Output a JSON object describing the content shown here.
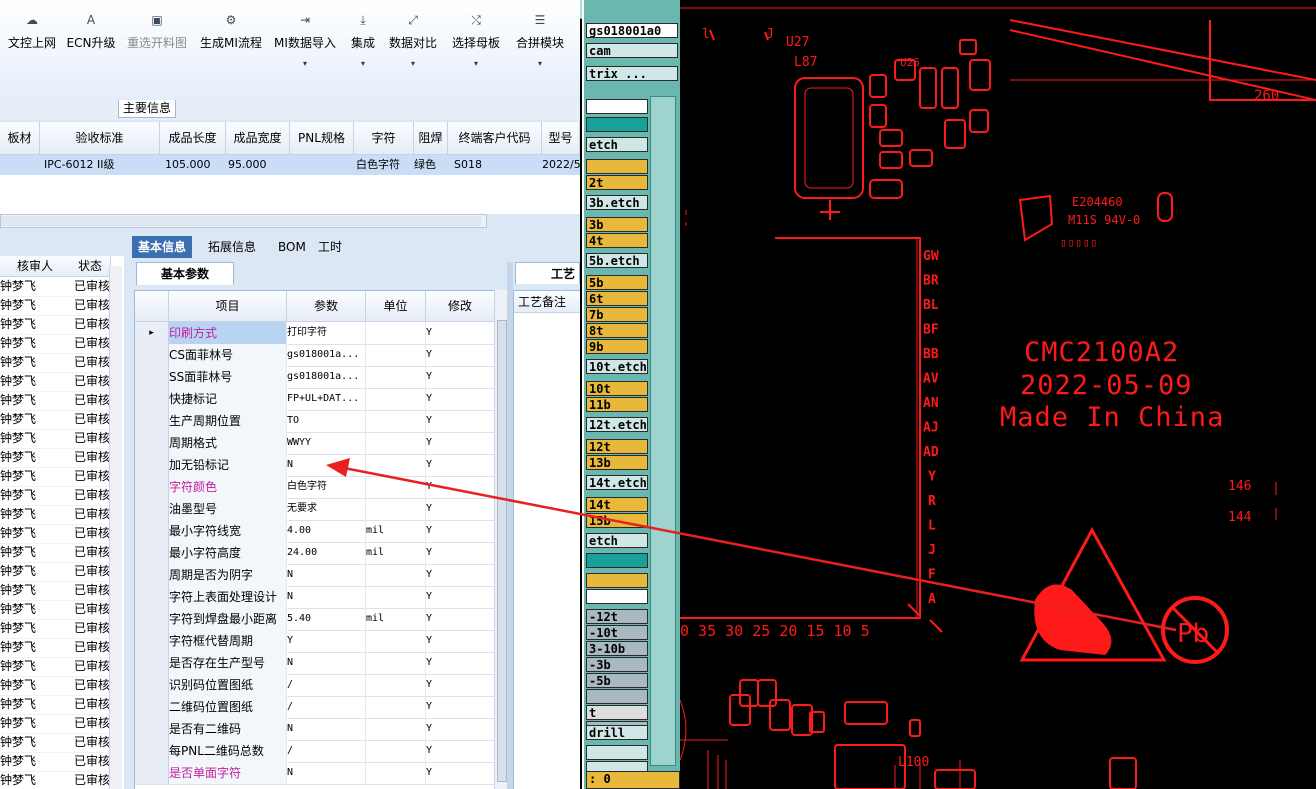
{
  "toolbar": {
    "items": [
      {
        "label": "文控上网",
        "icon": "cloud-icon",
        "glyph": "☁",
        "dropdown": false,
        "disabled": false
      },
      {
        "label": "ECN升级",
        "icon": "letter-a-icon",
        "glyph": "A",
        "dropdown": false,
        "disabled": false
      },
      {
        "label": "重选开料图",
        "icon": "image-icon",
        "glyph": "▣",
        "dropdown": false,
        "disabled": true
      },
      {
        "label": "生成MI流程",
        "icon": "gears-icon",
        "glyph": "⚙",
        "dropdown": false,
        "disabled": false
      },
      {
        "label": "MI数据导入",
        "icon": "import-icon",
        "glyph": "⇥",
        "dropdown": true,
        "disabled": false
      },
      {
        "label": "集成",
        "icon": "download-icon",
        "glyph": "⤓",
        "dropdown": true,
        "disabled": false
      },
      {
        "label": "数据对比",
        "icon": "compare-icon",
        "glyph": "⤢",
        "dropdown": true,
        "disabled": false
      },
      {
        "label": "选择母板",
        "icon": "shuffle-icon",
        "glyph": "⤭",
        "dropdown": true,
        "disabled": false
      },
      {
        "label": "合拼模块",
        "icon": "list-icon",
        "glyph": "☰",
        "dropdown": true,
        "disabled": false
      }
    ],
    "dropdown_glyph": "▾"
  },
  "main_info": {
    "title": "主要信息",
    "columns": [
      "板材",
      "验收标准",
      "成品长度",
      "成品宽度",
      "PNL规格",
      "字符",
      "阻焊",
      "终端客户代码",
      "型号"
    ],
    "row": [
      "",
      "IPC-6012 II级",
      "105.000",
      "95.000",
      "",
      "白色字符",
      "绿色",
      "S018",
      "2022/5"
    ]
  },
  "left_list": {
    "columns": [
      "核审人",
      "状态"
    ],
    "reviewer": "钟梦飞",
    "status": "已审核",
    "row_count": 27
  },
  "detail_tabs": {
    "tabs": [
      "基本信息",
      "拓展信息",
      "BOM",
      "工时"
    ],
    "active": "基本信息",
    "subtab": "基本参数",
    "side_tab": "工艺",
    "side_column": "工艺备注"
  },
  "params": {
    "columns": [
      "项目",
      "参数",
      "单位",
      "修改"
    ],
    "current_row_marker": "▸",
    "rows": [
      {
        "item": "印刷方式",
        "value": "打印字符",
        "unit": "",
        "mod": "Y",
        "highlight": true
      },
      {
        "item": "CS面菲林号",
        "value": "gs018001a...",
        "unit": "",
        "mod": "Y",
        "highlight": false
      },
      {
        "item": "SS面菲林号",
        "value": "gs018001a...",
        "unit": "",
        "mod": "Y",
        "highlight": false
      },
      {
        "item": "快捷标记",
        "value": "FP+UL+DAT...",
        "unit": "",
        "mod": "Y",
        "highlight": false
      },
      {
        "item": "生产周期位置",
        "value": "TO",
        "unit": "",
        "mod": "Y",
        "highlight": false
      },
      {
        "item": "周期格式",
        "value": "WWYY",
        "unit": "",
        "mod": "Y",
        "highlight": false
      },
      {
        "item": "加无铅标记",
        "value": "N",
        "unit": "",
        "mod": "Y",
        "highlight": false
      },
      {
        "item": "字符颜色",
        "value": "白色字符",
        "unit": "",
        "mod": "Y",
        "highlight": true
      },
      {
        "item": "油墨型号",
        "value": "无要求",
        "unit": "",
        "mod": "Y",
        "highlight": false
      },
      {
        "item": "最小字符线宽",
        "value": "4.00",
        "unit": "mil",
        "mod": "Y",
        "highlight": false
      },
      {
        "item": "最小字符高度",
        "value": "24.00",
        "unit": "mil",
        "mod": "Y",
        "highlight": false
      },
      {
        "item": "周期是否为阴字",
        "value": "N",
        "unit": "",
        "mod": "Y",
        "highlight": false
      },
      {
        "item": "字符上表面处理设计",
        "value": "N",
        "unit": "",
        "mod": "Y",
        "highlight": false
      },
      {
        "item": "字符到焊盘最小距离",
        "value": "5.40",
        "unit": "mil",
        "mod": "Y",
        "highlight": false
      },
      {
        "item": "字符框代替周期",
        "value": "Y",
        "unit": "",
        "mod": "Y",
        "highlight": false
      },
      {
        "item": "是否存在生产型号",
        "value": "N",
        "unit": "",
        "mod": "Y",
        "highlight": false
      },
      {
        "item": "识别码位置图纸",
        "value": "/",
        "unit": "",
        "mod": "Y",
        "highlight": false
      },
      {
        "item": "二维码位置图纸",
        "value": "/",
        "unit": "",
        "mod": "Y",
        "highlight": false
      },
      {
        "item": "是否有二维码",
        "value": "N",
        "unit": "",
        "mod": "Y",
        "highlight": false
      },
      {
        "item": "每PNL二维码总数",
        "value": "/",
        "unit": "",
        "mod": "Y",
        "highlight": false
      },
      {
        "item": "是否单面字符",
        "value": "N",
        "unit": "",
        "mod": "Y",
        "highlight": true
      }
    ]
  },
  "layers": [
    {
      "name": "gs018001a0",
      "bg": "#ffffff"
    },
    {
      "name": "cam",
      "bg": "#cfe8e6"
    },
    {
      "name": "trix ...",
      "bg": "#cfe8e6"
    },
    {
      "name": "",
      "bg": "#ffffff"
    },
    {
      "name": "",
      "bg": "#1aa09a"
    },
    {
      "name": "etch",
      "bg": "#cfe8e6"
    },
    {
      "name": "",
      "bg": "#e8b83a"
    },
    {
      "name": "2t",
      "bg": "#e8b83a"
    },
    {
      "name": "3b.etch",
      "bg": "#cfe8e6"
    },
    {
      "name": "3b",
      "bg": "#e8b83a"
    },
    {
      "name": "4t",
      "bg": "#e8b83a"
    },
    {
      "name": "5b.etch",
      "bg": "#cfe8e6"
    },
    {
      "name": "5b",
      "bg": "#e8b83a"
    },
    {
      "name": "6t",
      "bg": "#e8b83a"
    },
    {
      "name": "7b",
      "bg": "#e8b83a"
    },
    {
      "name": "8t",
      "bg": "#e8b83a"
    },
    {
      "name": "9b",
      "bg": "#e8b83a"
    },
    {
      "name": "10t.etch",
      "bg": "#cfe8e6"
    },
    {
      "name": "10t",
      "bg": "#e8b83a"
    },
    {
      "name": "11b",
      "bg": "#e8b83a"
    },
    {
      "name": "12t.etch",
      "bg": "#cfe8e6"
    },
    {
      "name": "12t",
      "bg": "#e8b83a"
    },
    {
      "name": "13b",
      "bg": "#e8b83a"
    },
    {
      "name": "14t.etch",
      "bg": "#cfe8e6"
    },
    {
      "name": "14t",
      "bg": "#e8b83a"
    },
    {
      "name": "15b",
      "bg": "#e8b83a"
    },
    {
      "name": "etch",
      "bg": "#cfe8e6"
    },
    {
      "name": "",
      "bg": "#1aa09a"
    },
    {
      "name": "",
      "bg": "#e8b83a"
    },
    {
      "name": "",
      "bg": "#ffffff"
    },
    {
      "name": "-12t",
      "bg": "#a9b9c2"
    },
    {
      "name": "-10t",
      "bg": "#a9b9c2"
    },
    {
      "name": "3-10b",
      "bg": "#a9b9c2"
    },
    {
      "name": "-3b",
      "bg": "#a9b9c2"
    },
    {
      "name": "-5b",
      "bg": "#a9b9c2"
    },
    {
      "name": "",
      "bg": "#a9b9c2"
    },
    {
      "name": "t",
      "bg": "#dddddd"
    },
    {
      "name": "",
      "bg": "#a9b9c2"
    },
    {
      "name": "drill",
      "bg": "#cfe8e6"
    },
    {
      "name": "",
      "bg": "#cfe8e6"
    },
    {
      "name": "",
      "bg": "#cfe8e6"
    },
    {
      "name": ": 0",
      "bg": "#e8b83a"
    }
  ],
  "cad": {
    "color": "#ff1a1a",
    "refdes": [
      "U27",
      "L87",
      "U26",
      "L100"
    ],
    "dim_260": "260",
    "ul_code": "E204460",
    "ul_rating": "M11S 94V-0",
    "letter_column": [
      "GW",
      "BR",
      "BL",
      "BF",
      "BB",
      "AV",
      "AN",
      "AJ",
      "AD",
      "Y",
      "R",
      "L",
      "J",
      "F",
      "A"
    ],
    "scale_numbers": "0 35 30 25 20 15 10 5",
    "side_numbers": [
      "146",
      "144"
    ],
    "text_line1": "CMC2100A2",
    "text_line2": "2022-05-09",
    "text_line3": "Made In China",
    "pb_label": "Pb",
    "esd_icon": "esd-warning-icon",
    "arrow_color": "#e82020"
  }
}
